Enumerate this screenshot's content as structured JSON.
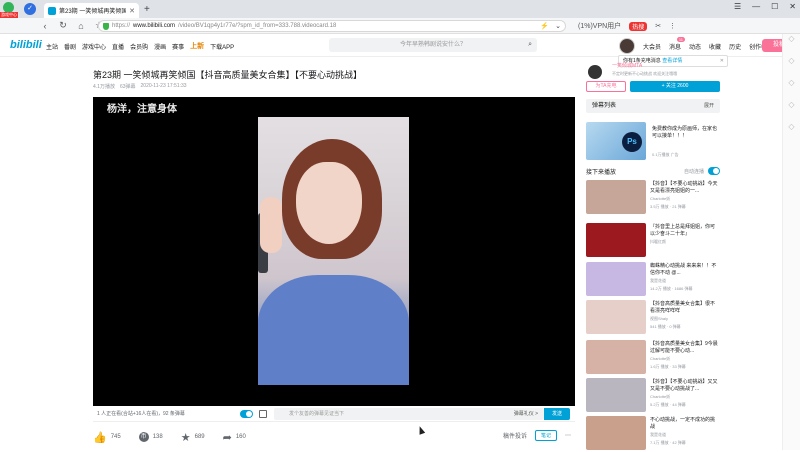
{
  "browser": {
    "app_badge": "游戏中心",
    "tab_title": "第23期 一笑倾城再笑倾国【抖...",
    "new_tab": "+",
    "window_controls": [
      "☰",
      "—",
      "☐",
      "✕"
    ],
    "url_prefix": "https://",
    "url_host": "www.bilibili.com",
    "url_path": "/video/BV1qp4y1r77e/?spm_id_from=333.788.videocard.18",
    "nav_right": [
      "(1%)VPN用户",
      "热搜",
      "✂",
      "⋮"
    ]
  },
  "header": {
    "logo": "bilibili",
    "nav": [
      "主站",
      "番剧",
      "游戏中心",
      "直播",
      "会员购",
      "漫画",
      "赛事",
      "上新",
      "下载APP"
    ],
    "search_placeholder": "今年早熟韩剧说安什么？",
    "user_nav": [
      "大会员",
      "消息",
      "动态",
      "收藏",
      "历史",
      "创作中心"
    ],
    "msg_count": "11",
    "post_button": "投稿"
  },
  "video": {
    "title": "第23期 一笑倾城再笑倾国【抖音高质量美女合集】【不要心动挑战】",
    "views": "4.1万播放",
    "danmaku_count": "63弹幕",
    "date": "2020-11-23 17:51:33",
    "watermark": "杨洋，注意身体"
  },
  "controls": {
    "watching": "1 人正在看(合站+16人在看)，92 条弹幕",
    "danmaku_placeholder": "发个友善的弹幕见证当下",
    "etiquette": "弹幕礼仪 >",
    "send": "发送"
  },
  "actions": {
    "like": "745",
    "coin": "138",
    "fav": "689",
    "share": "160",
    "report": "稿件投诉",
    "note": "笔记",
    "more": "⋯"
  },
  "up": {
    "popup_text": "你有1条充电消息",
    "popup_link": "查看详情",
    "name": "一笑倾城MTA",
    "desc": "不定时更新不心动挑战 欢迎关注哦哦",
    "charge": "为TA充电",
    "follow": "+ 关注 2600"
  },
  "danmaku_list": {
    "label": "弹幕列表",
    "more": "展开"
  },
  "ad": {
    "text": "免费教你成为原画师，在家也可以接单！！！",
    "source": "广告",
    "count": "0.1万播放",
    "ps_label": "Ps"
  },
  "next_up": {
    "label": "接下来播放",
    "autoplay": "自动连播"
  },
  "recommendations": [
    {
      "title": "【抖音】【不要心动挑战】今天又是看漂亮姐姐的一...",
      "author": "Charlotte妖",
      "stats": "3.5万 播放  · 21 弹幕",
      "color": "#c7a69a"
    },
    {
      "title": "『抖音里上总是拜姐姐，你可以少奋斗二十年』",
      "author": "抖暖红颜",
      "stats": "",
      "color": "#9c1a1f"
    },
    {
      "title": "蜘蛛精心动挑战 来来来！！不信你不动 @...",
      "author": "我是花道",
      "stats": "14.2万 播放  · 1686 弹幕",
      "color": "#c6b7e3"
    },
    {
      "title": "【抖音高质量美女合集】很不看漂亮咩咩咩",
      "author": "视图Shaly",
      "stats": "541 播放  · 0 弹幕",
      "color": "#e6cfc8"
    },
    {
      "title": "【抖音高质量美女合集】9今晨过解可能不要心动...",
      "author": "Charlotte妖",
      "stats": "1.6万 播放  · 33 弹幕",
      "color": "#d6b2a6"
    },
    {
      "title": "【抖音】【不要心动挑战】又又又是不要心动挑战了...",
      "author": "Charlotte妖",
      "stats": "5.2万 播放  · 44 弹幕",
      "color": "#b9b6c0"
    },
    {
      "title": "不心动挑战，一定不成功的挑战",
      "author": "我是花道",
      "stats": "7.1万 播放  · 42 弹幕",
      "color": "#c8a08c"
    }
  ]
}
